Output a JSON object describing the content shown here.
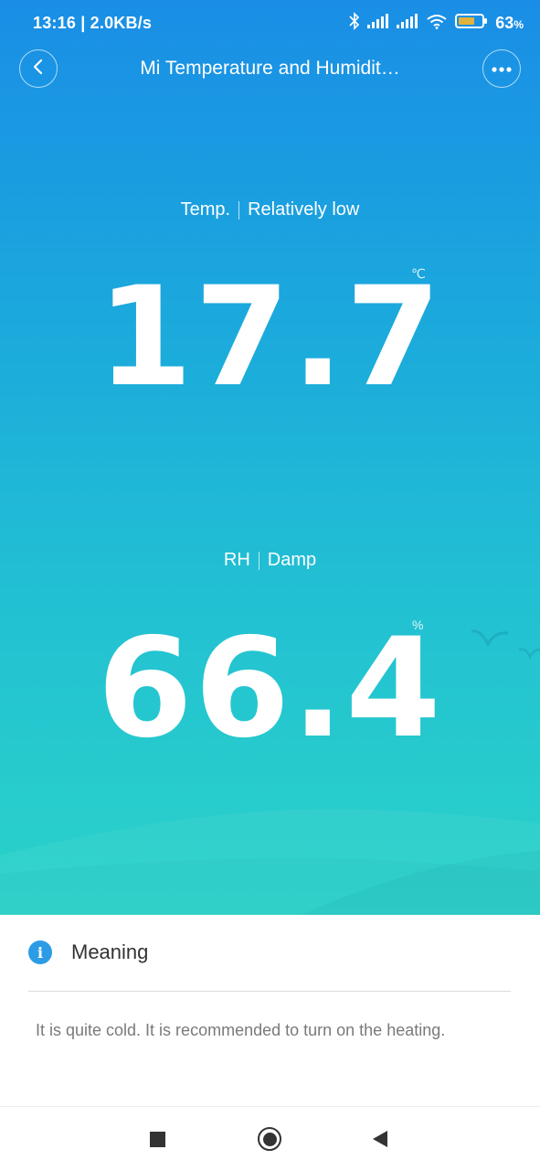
{
  "status_bar": {
    "time_speed": "13:16 | 2.0KB/s",
    "battery_percent": "63",
    "battery_suffix": "%",
    "icons": [
      "bluetooth-icon",
      "signal-icon",
      "signal-icon",
      "wifi-icon",
      "battery-icon"
    ]
  },
  "header": {
    "title": "Mi Temperature and Humidit…",
    "back_icon": "chevron-left-icon",
    "more_icon": "more-horizontal-icon"
  },
  "temperature": {
    "label": "Temp.",
    "status": "Relatively low",
    "value": "17.7",
    "unit": "℃"
  },
  "humidity": {
    "label": "RH",
    "status": "Damp",
    "value": "66.4",
    "unit": "%"
  },
  "meaning": {
    "icon": "info-icon",
    "title": "Meaning",
    "text": "It is quite cold. It is recommended to turn on the heating."
  },
  "nav": {
    "buttons": [
      "recents-icon",
      "home-icon",
      "back-icon"
    ]
  },
  "colors": {
    "gradient_top": "#1a8ee6",
    "gradient_bottom": "#2ad3c8",
    "info_blue": "#2c9ce6"
  }
}
